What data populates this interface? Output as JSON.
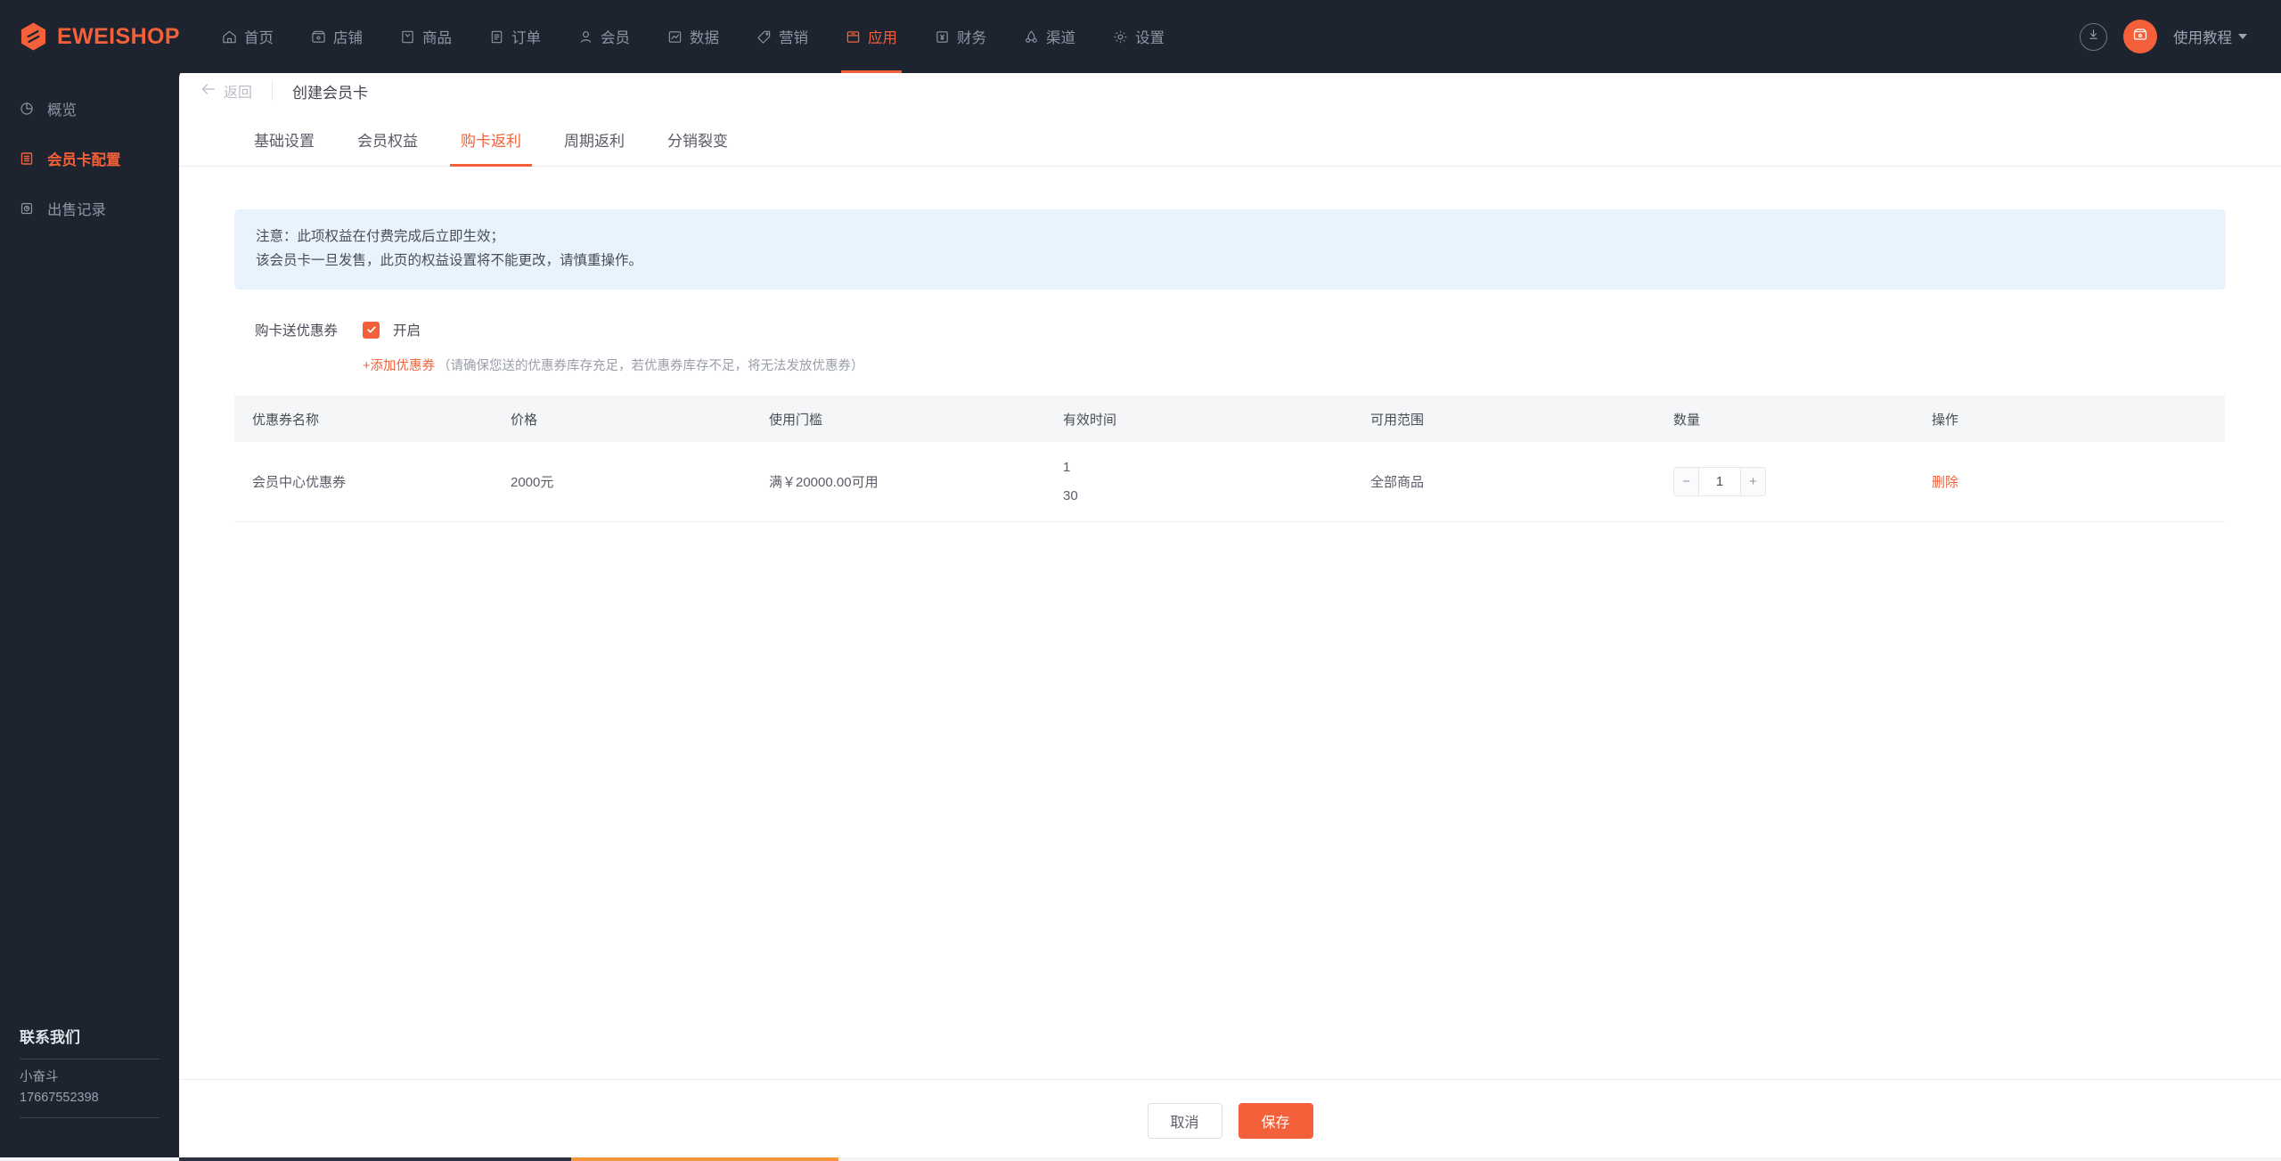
{
  "brand": {
    "name": "EWEISHOP",
    "logo_icon": "hexagon-logo-icon"
  },
  "topnav": {
    "items": [
      {
        "label": "首页",
        "icon": "home-icon",
        "active": false
      },
      {
        "label": "店铺",
        "icon": "shop-icon",
        "active": false
      },
      {
        "label": "商品",
        "icon": "goods-icon",
        "active": false
      },
      {
        "label": "订单",
        "icon": "order-icon",
        "active": false
      },
      {
        "label": "会员",
        "icon": "member-icon",
        "active": false
      },
      {
        "label": "数据",
        "icon": "chart-icon",
        "active": false
      },
      {
        "label": "营销",
        "icon": "tag-icon",
        "active": false
      },
      {
        "label": "应用",
        "icon": "app-box-icon",
        "active": true
      },
      {
        "label": "财务",
        "icon": "finance-yuan-icon",
        "active": false
      },
      {
        "label": "渠道",
        "icon": "channel-icon",
        "active": false
      },
      {
        "label": "设置",
        "icon": "gear-icon",
        "active": false
      }
    ],
    "download_icon": "download-icon",
    "avatar_icon": "shop-avatar-icon",
    "tutorial_label": "使用教程",
    "tutorial_caret_icon": "chevron-down-icon"
  },
  "sidebar": {
    "items": [
      {
        "label": "概览",
        "icon": "overview-pie-icon",
        "active": false
      },
      {
        "label": "会员卡配置",
        "icon": "card-config-icon",
        "active": true
      },
      {
        "label": "出售记录",
        "icon": "sales-record-icon",
        "active": false
      }
    ],
    "contact": {
      "title": "联系我们",
      "name": "小奋斗",
      "phone": "17667552398"
    }
  },
  "page": {
    "back_label": "返回",
    "back_icon": "arrow-left-icon",
    "title": "创建会员卡"
  },
  "tabs": [
    {
      "label": "基础设置",
      "active": false
    },
    {
      "label": "会员权益",
      "active": false
    },
    {
      "label": "购卡返利",
      "active": true
    },
    {
      "label": "周期返利",
      "active": false
    },
    {
      "label": "分销裂变",
      "active": false
    }
  ],
  "notice": {
    "line1": "注意：此项权益在付费完成后立即生效；",
    "line2": "该会员卡一旦发售，此页的权益设置将不能更改，请慎重操作。"
  },
  "coupon_setting": {
    "label": "购卡送优惠券",
    "checkbox_checked": true,
    "checkbox_icon": "check-icon",
    "switch_label": "开启",
    "add_link": "+添加优惠券",
    "add_hint": "（请确保您送的优惠券库存充足，若优惠券库存不足，将无法发放优惠券）"
  },
  "table": {
    "columns": [
      "优惠券名称",
      "价格",
      "使用门槛",
      "有效时间",
      "可用范围",
      "数量",
      "操作"
    ],
    "rows": [
      {
        "name": "会员中心优惠券",
        "price": "2000元",
        "threshold": "满￥20000.00可用",
        "valid_line1": "1",
        "valid_line2": "30",
        "scope": "全部商品",
        "quantity": "1",
        "minus_label": "−",
        "plus_label": "+",
        "action": "删除"
      }
    ]
  },
  "footer": {
    "cancel_label": "取消",
    "save_label": "保存"
  },
  "colors": {
    "accent": "#f4603a",
    "dark": "#1d2430",
    "notice_bg": "#e8f3fd",
    "table_head_bg": "#f5f6f8"
  }
}
